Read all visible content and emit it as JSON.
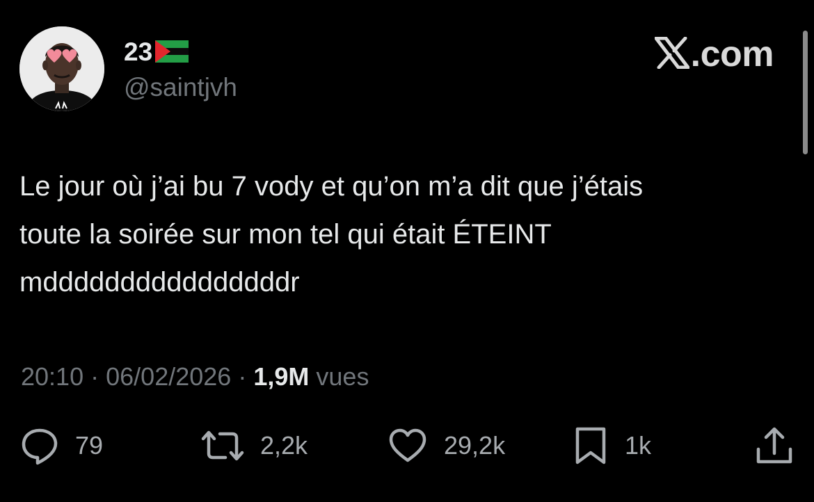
{
  "author": {
    "display_name": "23",
    "flag_icon": "flag-icon",
    "handle": "@saintjvh"
  },
  "brand": {
    "label": ".com",
    "logo_icon": "x-logo-icon"
  },
  "tweet": {
    "lines": [
      "Le jour où j’ai bu 7 vody et qu’on m’a dit que j’étais",
      "toute la soirée sur mon tel qui était ÉTEINT",
      "mddddddddddddddddr"
    ],
    "time": "20:10",
    "separator": "·",
    "date": "06/02/2026",
    "views_count": "1,9M",
    "views_label": "vues"
  },
  "actions": {
    "reply": {
      "icon": "reply-icon",
      "count": "79"
    },
    "repost": {
      "icon": "repost-icon",
      "count": "2,2k"
    },
    "like": {
      "icon": "heart-icon",
      "count": "29,2k"
    },
    "bookmark": {
      "icon": "bookmark-icon",
      "count": "1k"
    },
    "share": {
      "icon": "share-icon"
    }
  },
  "colors": {
    "background": "#000000",
    "primary_text": "#e7e9ea",
    "secondary_text": "#71767b",
    "icon": "#a8acb0"
  }
}
